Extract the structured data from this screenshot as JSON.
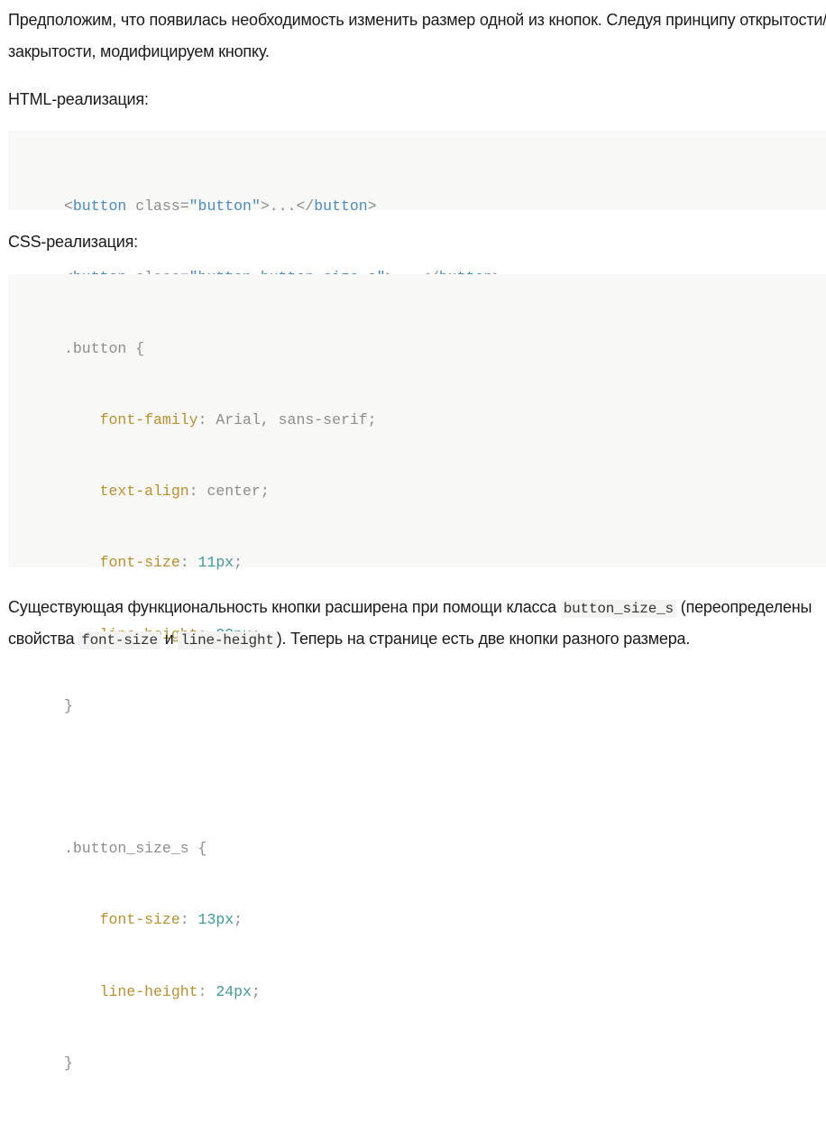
{
  "intro": {
    "line1": "Предположим, что появилась необходимость изменить размер одной из кнопок. Следуя принципу открытости/",
    "line2": "закрытости, модифицируем кнопку."
  },
  "html_heading": "HTML-реализация:",
  "html_code": {
    "line1": {
      "lt": "<",
      "tag": "button",
      "attr": " class=",
      "str": "\"button\"",
      "gt": ">...</",
      "tag2": "button",
      "end": ">"
    },
    "line2": {
      "lt": "<",
      "tag": "button",
      "attr": " class=",
      "str": "\"button button_size_s\"",
      "gt": ">...</",
      "tag2": "button",
      "end": ">"
    }
  },
  "css_heading": "CSS-реализация:",
  "css_code": {
    "rule1_selector": ".button {",
    "rule1_decls": [
      {
        "prop": "font-family",
        "colon": ": ",
        "value": "Arial, sans-serif",
        "semi": ";"
      },
      {
        "prop": "text-align",
        "colon": ": ",
        "value": "center",
        "semi": ";"
      },
      {
        "prop": "font-size",
        "colon": ": ",
        "value": "11px",
        "semi": ";"
      },
      {
        "prop": "line-height",
        "colon": ": ",
        "value": "20px",
        "semi": ";"
      }
    ],
    "rule1_close": "}",
    "rule2_selector": ".button_size_s {",
    "rule2_decls": [
      {
        "prop": "font-size",
        "colon": ": ",
        "value": "13px",
        "semi": ";"
      },
      {
        "prop": "line-height",
        "colon": ": ",
        "value": "24px",
        "semi": ";"
      }
    ],
    "rule2_close": "}"
  },
  "outro": {
    "line1_a": "Существующая функциональность кнопки расширена при помощи класса ",
    "line1_code": "button_size_s",
    "line1_b": " (переопределены",
    "line2_a": "свойства ",
    "line2_code1": "font-size",
    "line2_b": " и ",
    "line2_code2": "line-height",
    "line2_c": "). Теперь на странице есть две кнопки разного размера."
  }
}
